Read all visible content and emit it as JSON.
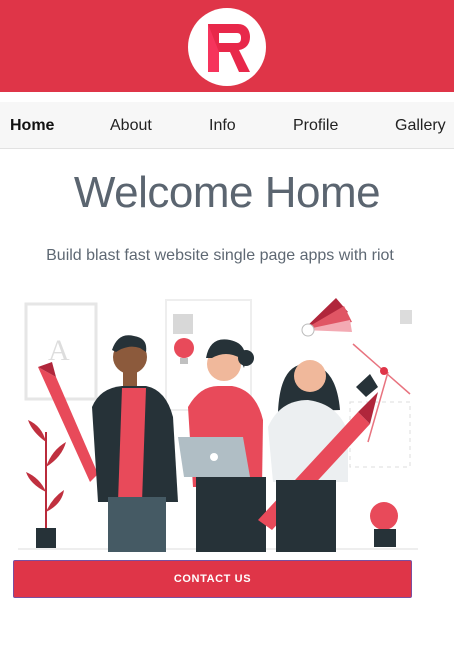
{
  "colors": {
    "brand": "#df3548",
    "nav_background": "#f7f7f7",
    "heading_text": "#5b6570",
    "cta_border": "#7a4fa0"
  },
  "header": {
    "logo_icon": "brand-logo-icon"
  },
  "nav": {
    "items": [
      {
        "label": "Home",
        "active": true
      },
      {
        "label": "About",
        "active": false
      },
      {
        "label": "Info",
        "active": false
      },
      {
        "label": "Profile",
        "active": false
      },
      {
        "label": "Gallery",
        "active": false
      }
    ]
  },
  "hero": {
    "title": "Welcome Home",
    "subtitle": "Build blast fast website single page apps with riot",
    "illustration_icon": "team-illustration-icon"
  },
  "cta": {
    "label": "CONTACT US"
  }
}
